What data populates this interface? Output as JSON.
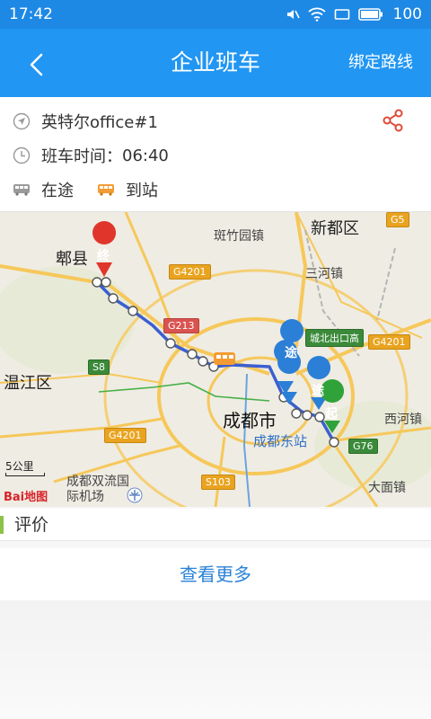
{
  "status_bar": {
    "time": "17:42",
    "battery": "100"
  },
  "app_bar": {
    "title": "企业班车",
    "action": "绑定路线"
  },
  "info": {
    "route_name": "英特尔office#1",
    "time_label": "班车时间：",
    "time_value": "06:40",
    "legend_on_way": "在途",
    "legend_arrived": "到站"
  },
  "map": {
    "labels": {
      "pixian": "郫县",
      "banzhuyuan": "斑竹园镇",
      "xindu": "新都区",
      "sanhe": "三河镇",
      "wenjiang": "温江区",
      "chengdu": "成都市",
      "chengdu_east": "成都东站",
      "shuangliu": "成都双流国际机场",
      "xiyang": "西河镇",
      "dami": "大面镇",
      "chengbei": "城北出口高"
    },
    "roads": [
      "G4201",
      "G213",
      "S8",
      "G4201",
      "G4201",
      "G5",
      "G76",
      "S103"
    ],
    "markers": {
      "end": "终",
      "start": "起",
      "via": "途"
    },
    "scale": "5公里",
    "logo": "Bai地图"
  },
  "rating": {
    "title": "评价"
  },
  "more": {
    "label": "查看更多"
  }
}
